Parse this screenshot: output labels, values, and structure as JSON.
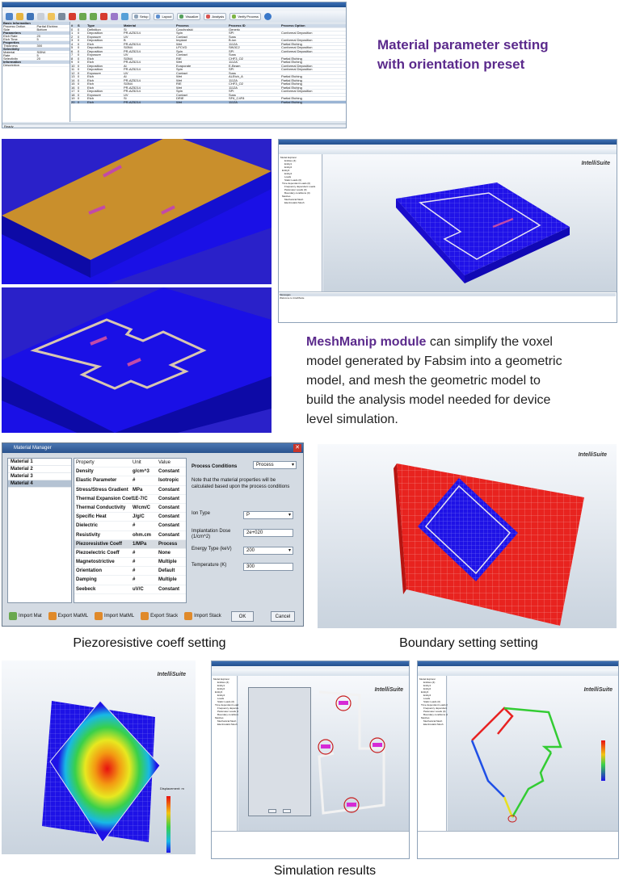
{
  "top_app": {
    "toolbar_buttons": [
      "Setup",
      "Layout",
      "Visualize",
      "Analysis",
      "Verify Process"
    ],
    "grid_headers": [
      "#",
      "S",
      "Type",
      "Material",
      "Process",
      "Process ID",
      "Process Option"
    ],
    "rows": [
      [
        "0",
        "0",
        "Definition",
        "Si",
        "Czochralski",
        "Generic",
        ""
      ],
      [
        "1",
        "0",
        "Deposition",
        "PR-AZ5214",
        "Spin",
        "SPI",
        "Conformal Deposition"
      ],
      [
        "2",
        "0",
        "Exposure",
        "UV",
        "Contact",
        "Suss",
        ""
      ],
      [
        "3",
        "0",
        "Deposition",
        "B",
        "Implant",
        "B-ion",
        "Conformal Deposition"
      ],
      [
        "4",
        "0",
        "Etch",
        "PR-AZ5214",
        "Wet",
        "1112A",
        "Partial Etching"
      ],
      [
        "5",
        "0",
        "Deposition",
        "Si3N4",
        "LPCVD",
        "SiN3C2",
        "Conformal Deposition"
      ],
      [
        "6",
        "0",
        "Deposition",
        "PR-AZ5214",
        "Spin",
        "SPI",
        "Conformal Deposition"
      ],
      [
        "7",
        "0",
        "Exposure",
        "UV",
        "Contact",
        "Suss",
        ""
      ],
      [
        "8",
        "0",
        "Etch",
        "Si3N4",
        "RIE",
        "CHF3_O2",
        "Partial Etching"
      ],
      [
        "9",
        "0",
        "Etch",
        "PR-AZ5214",
        "Wet",
        "1112A",
        "Partial Etching"
      ],
      [
        "10",
        "0",
        "Deposition",
        "Al",
        "Evaporate",
        "E-Beam",
        "Conformal Deposition"
      ],
      [
        "11",
        "0",
        "Deposition",
        "PR-AZ5214",
        "Spin",
        "SPI",
        "Conformal Deposition"
      ],
      [
        "12",
        "0",
        "Exposure",
        "UV",
        "Contact",
        "Suss",
        ""
      ],
      [
        "13",
        "0",
        "Etch",
        "Al",
        "Wet",
        "ALEtch_A",
        "Partial Etching"
      ],
      [
        "14",
        "0",
        "Etch",
        "PR-AZ5214",
        "Wet",
        "1112A",
        "Partial Etching"
      ],
      [
        "15",
        "0",
        "Etch",
        "Si3N4",
        "RIE",
        "CHF3_O2",
        "Partial Etching"
      ],
      [
        "16",
        "0",
        "Etch",
        "PR-AZ5214",
        "Wet",
        "1112A",
        "Partial Etching"
      ],
      [
        "17",
        "0",
        "Deposition",
        "PR-AZ5214",
        "Spin",
        "SPI",
        "Conformal Deposition"
      ],
      [
        "18",
        "0",
        "Exposure",
        "UV",
        "Contact",
        "Suss",
        ""
      ],
      [
        "19",
        "0",
        "Etch",
        "Si",
        "DRIE",
        "SF6_C4F8",
        "Partial Etching"
      ],
      [
        "20",
        "0",
        "Etch",
        "PR-AZ5214",
        "Wet",
        "1112A",
        "Partial Etching"
      ]
    ],
    "prop_sections": [
      {
        "title": "Basic Information",
        "rows": [
          [
            "Process Option",
            "Partial Etching"
          ],
          [
            "Side",
            "Bottom"
          ]
        ]
      },
      {
        "title": "Parameters",
        "rows": [
          [
            "Etch Rate",
            "20"
          ],
          [
            "Etch Time",
            "5"
          ]
        ]
      },
      {
        "title": "Properties",
        "rows": [
          [
            "Thickness",
            "300"
          ]
        ]
      },
      {
        "title": "Selectivity",
        "rows": [
          [
            "Material",
            "Si3N4"
          ],
          [
            "Rate",
            "5"
          ],
          [
            "Selectivity",
            "20"
          ]
        ]
      },
      {
        "title": "Information",
        "rows": [
          [
            "Description",
            ""
          ]
        ]
      }
    ],
    "status": "Ready"
  },
  "caption_top": [
    "Material parameter setting",
    "with orientation preset"
  ],
  "meshmanip": {
    "lead": "MeshManip module",
    "text_lines": [
      " can simplify the voxel",
      "model generated by Fabsim into a geometric",
      "model, and mesh the geometric model to",
      "build the analysis model needed for device",
      "level simulation."
    ],
    "brand": "IntelliSuite",
    "tree_items": [
      "Model Explorer",
      "Entities (4)",
      "Entity1",
      "Entity2",
      "Entity3",
      "Entity4",
      "Loads",
      "Static Loads (0)",
      "Time dependent Loads (0)",
      "Frequency dependent Loads",
      "Parameter Loads (0)",
      "Boundary conditions (0)",
      "Meshes",
      "Mechanical Mesh",
      "Electrostatic Mesh"
    ],
    "message_title": "Messages",
    "message": "Welcome to IntelliSuite"
  },
  "material_manager": {
    "title": "Material Manager",
    "materials": [
      "Material 1",
      "Material 2",
      "Material 3",
      "Material 4"
    ],
    "headers": [
      "Property",
      "Unit",
      "Value"
    ],
    "properties": [
      [
        "Density",
        "g/cm^3",
        "Constant"
      ],
      [
        "Elastic Parameter",
        "#",
        "Isotropic"
      ],
      [
        "Stress/Stress Gradient",
        "MPa",
        "Constant"
      ],
      [
        "Thermal Expansion Coeff",
        "1E-7/C",
        "Constant"
      ],
      [
        "Thermal Conductivity",
        "W/cm/C",
        "Constant"
      ],
      [
        "Specific Heat",
        "J/g/C",
        "Constant"
      ],
      [
        "Dielectric",
        "#",
        "Constant"
      ],
      [
        "Resistivity",
        "ohm.cm",
        "Constant"
      ],
      [
        "Piezoresistive Coeff",
        "1/MPa",
        "Process"
      ],
      [
        "Piezoelectric Coeff",
        "#",
        "None"
      ],
      [
        "Magnetostrictive",
        "#",
        "Multiple"
      ],
      [
        "Orientation",
        "#",
        "Default"
      ],
      [
        "Damping",
        "#",
        "Multiple"
      ],
      [
        "Seebeck",
        "uV/C",
        "Constant"
      ]
    ],
    "pc_label": "Process Conditions",
    "pc_value": "Process",
    "note": "Note that the material properties will be calculated based upon the process conditions",
    "fields": [
      {
        "label": "Ion Type",
        "value": "P"
      },
      {
        "label": "Implantation Dose (1/cm^2)",
        "value": "2e+020"
      },
      {
        "label": "Energy Type (keV)",
        "value": "200"
      },
      {
        "label": "Temperature (K)",
        "value": "300"
      }
    ],
    "buttons": [
      "Import Mat",
      "Export MatML",
      "Import MatML",
      "Export Stack",
      "Import Stack"
    ],
    "ok": "OK",
    "cancel": "Cancel"
  },
  "captions": {
    "piezo": "Piezoresistive coeff setting",
    "boundary": "Boundary  setting setting",
    "sim": "Simulation results"
  },
  "brand": "IntelliSuite",
  "colorbar_title": "Displacement: m",
  "colors": {
    "purple": "#5b2a8c",
    "blue": "#1a10e6",
    "red": "#e8231f"
  }
}
